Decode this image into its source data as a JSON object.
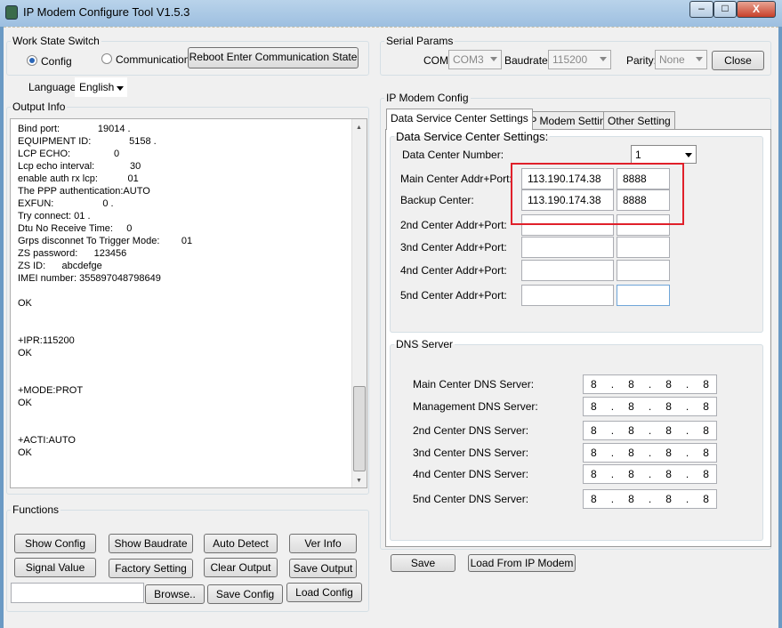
{
  "window": {
    "title": "IP Modem Configure Tool V1.5.3",
    "minimize": "–",
    "maximize": "□",
    "close": "X"
  },
  "work_state": {
    "legend": "Work State Switch",
    "config": "Config",
    "communication": "Communication",
    "selected": "Config",
    "reboot": "Reboot Enter Communication State"
  },
  "language": {
    "label": "Language",
    "value": "English"
  },
  "output": {
    "legend": "Output Info",
    "lines": [
      "Bind port:              19014 .",
      "EQUIPMENT ID:              5158 .",
      "LCP ECHO:                0",
      "Lcp echo interval:             30",
      "enable auth rx lcp:           01",
      "The PPP authentication:AUTO",
      "EXFUN:                  0 .",
      "Try connect: 01 .",
      "Dtu No Receive Time:     0",
      "Grps disconnet To Trigger Mode:        01",
      "ZS password:      123456",
      "ZS ID:      abcdefge",
      "IMEI number: 355897048798649",
      "",
      "OK",
      "",
      "",
      "+IPR:115200",
      "OK",
      "",
      "",
      "+MODE:PROT",
      "OK",
      "",
      "",
      "+ACTI:AUTO",
      "OK"
    ]
  },
  "functions": {
    "legend": "Functions",
    "show_config": "Show Config",
    "show_baudrate": "Show Baudrate",
    "auto_detect": "Auto Detect",
    "ver_info": "Ver Info",
    "signal_value": "Signal Value",
    "factory_setting": "Factory Setting",
    "clear_output": "Clear Output",
    "save_output": "Save Output",
    "path_value": "",
    "browse": "Browse..",
    "save_config": "Save Config",
    "load_config": "Load Config"
  },
  "serial": {
    "legend": "Serial Params",
    "com_label": "COM:",
    "com": "COM3",
    "baud_label": "Baudrate:",
    "baud": "115200",
    "parity_label": "Parity:",
    "parity": "None",
    "close": "Close"
  },
  "modem": {
    "legend": "IP Modem Config",
    "tabs": [
      "Data Service Center Settings",
      "IP Modem Setting",
      "Other Setting"
    ],
    "dsc_legend": "Data Service Center Settings:",
    "dcn_label": "Data Center Number:",
    "dcn": "1",
    "centers": [
      {
        "label": "Main Center Addr+Port:",
        "ip": "113.190.174.38",
        "port": "8888"
      },
      {
        "label": "Backup Center:",
        "ip": "113.190.174.38",
        "port": "8888"
      },
      {
        "label": "2nd Center Addr+Port:",
        "ip": "",
        "port": ""
      },
      {
        "label": "3nd Center Addr+Port:",
        "ip": "",
        "port": ""
      },
      {
        "label": "4nd Center Addr+Port:",
        "ip": "",
        "port": ""
      },
      {
        "label": "5nd Center Addr+Port:",
        "ip": "",
        "port": ""
      }
    ],
    "dns_legend": "DNS Server",
    "dns": [
      {
        "label": "Main Center DNS Server:",
        "ip": [
          "8",
          "8",
          "8",
          "8"
        ]
      },
      {
        "label": "Management DNS Server:",
        "ip": [
          "8",
          "8",
          "8",
          "8"
        ]
      },
      {
        "label": "2nd Center DNS Server:",
        "ip": [
          "8",
          "8",
          "8",
          "8"
        ]
      },
      {
        "label": "3nd Center DNS Server:",
        "ip": [
          "8",
          "8",
          "8",
          "8"
        ]
      },
      {
        "label": "4nd Center DNS Server:",
        "ip": [
          "8",
          "8",
          "8",
          "8"
        ]
      },
      {
        "label": "5nd Center DNS Server:",
        "ip": [
          "8",
          "8",
          "8",
          "8"
        ]
      }
    ],
    "save": "Save",
    "load": "Load From IP Modem"
  }
}
